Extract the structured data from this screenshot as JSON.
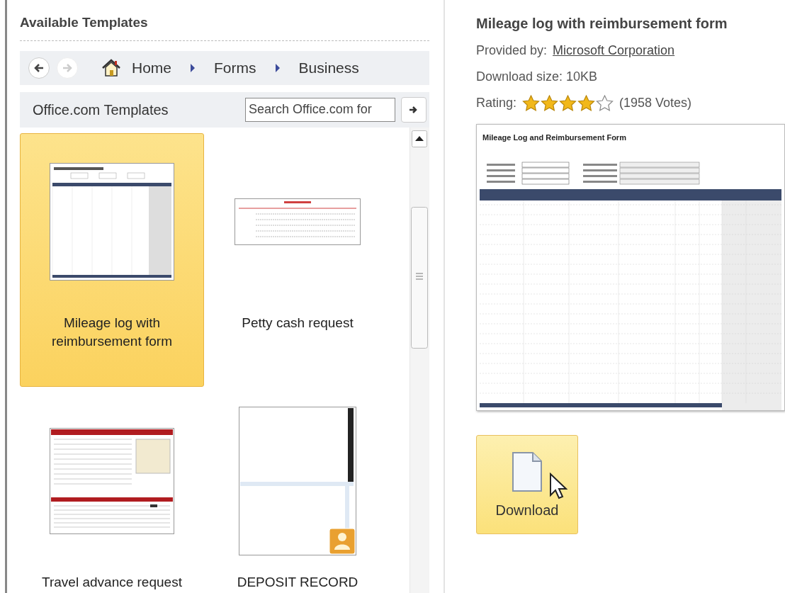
{
  "available_templates": {
    "title": "Available Templates"
  },
  "navigation": {
    "back": {
      "disabled": false
    },
    "forward": {
      "disabled": true
    }
  },
  "breadcrumb": [
    {
      "label": "Home",
      "kind": "home"
    },
    {
      "label": "Forms",
      "kind": "folder"
    },
    {
      "label": "Business",
      "kind": "folder"
    }
  ],
  "office_bar": {
    "title": "Office.com Templates",
    "search": {
      "placeholder": "Search Office.com for"
    }
  },
  "templates": [
    {
      "label": "Mileage log with reimbursement form",
      "selected": true,
      "kind": "table-form"
    },
    {
      "label": "Petty cash request",
      "selected": false,
      "kind": "receipt-form"
    },
    {
      "label": "Travel advance request",
      "selected": false,
      "kind": "request-form"
    },
    {
      "label": "DEPOSIT RECORD",
      "selected": false,
      "kind": "record-form"
    }
  ],
  "details": {
    "title": "Mileage log with reimbursement form",
    "provider_label": "Provided by:",
    "provider": "Microsoft Corporation",
    "size": "Download size: 10KB",
    "rating_label": "Rating:",
    "stars": 4,
    "votes": "(1958 Votes)",
    "preview_title": "Mileage Log and Reimbursement Form",
    "download": "Download"
  }
}
